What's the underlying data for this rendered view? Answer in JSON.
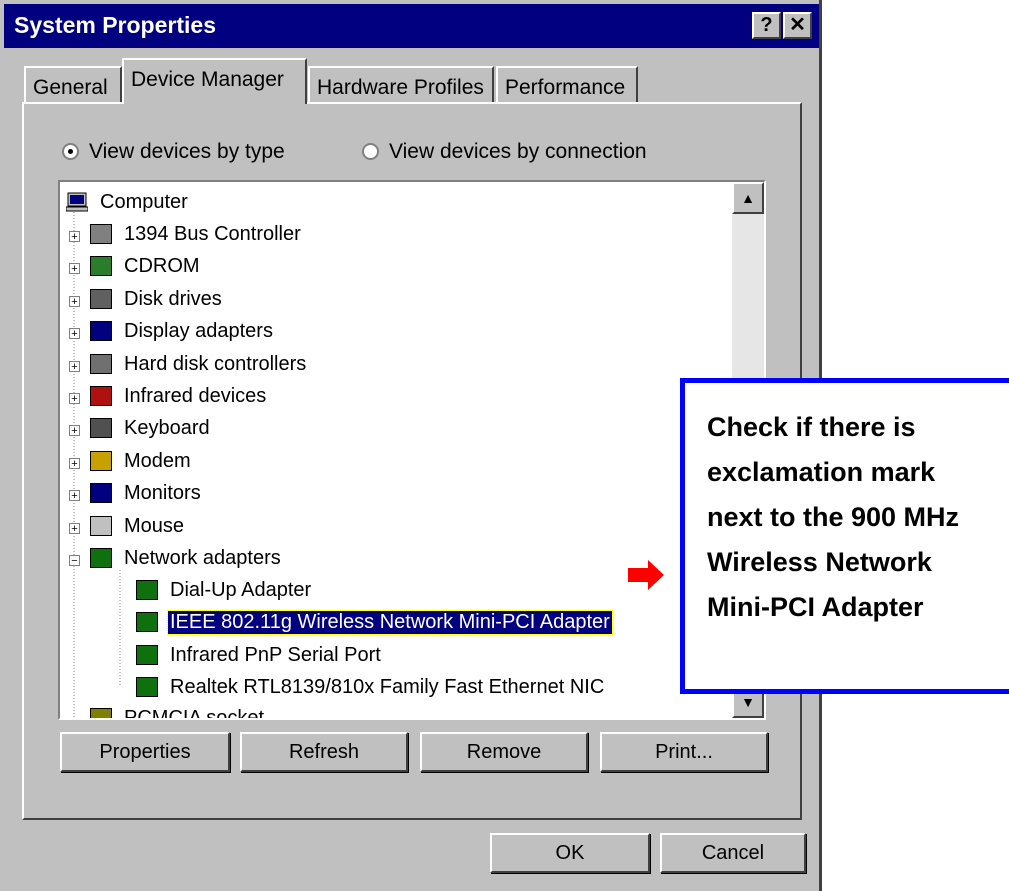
{
  "window": {
    "title": "System Properties",
    "help_label": "?",
    "close_label": "✕"
  },
  "tabs": [
    {
      "label": "General"
    },
    {
      "label": "Device Manager"
    },
    {
      "label": "Hardware Profiles"
    },
    {
      "label": "Performance"
    }
  ],
  "view_options": {
    "by_type": "View devices by type",
    "by_connection": "View devices by connection",
    "selected": "by_type"
  },
  "tree": {
    "root": "Computer",
    "items": [
      {
        "label": "1394 Bus Controller",
        "icon": "bus-controller-icon"
      },
      {
        "label": "CDROM",
        "icon": "cdrom-icon"
      },
      {
        "label": "Disk drives",
        "icon": "disk-drive-icon"
      },
      {
        "label": "Display adapters",
        "icon": "display-adapter-icon"
      },
      {
        "label": "Hard disk controllers",
        "icon": "hdd-controller-icon"
      },
      {
        "label": "Infrared devices",
        "icon": "infrared-icon"
      },
      {
        "label": "Keyboard",
        "icon": "keyboard-icon"
      },
      {
        "label": "Modem",
        "icon": "modem-icon"
      },
      {
        "label": "Monitors",
        "icon": "monitor-icon"
      },
      {
        "label": "Mouse",
        "icon": "mouse-icon"
      },
      {
        "label": "Network adapters",
        "icon": "network-adapter-icon"
      }
    ],
    "network_children": [
      {
        "label": "Dial-Up Adapter"
      },
      {
        "label": "IEEE 802.11g Wireless Network Mini-PCI Adapter"
      },
      {
        "label": "Infrared PnP Serial Port"
      },
      {
        "label": "Realtek RTL8139/810x Family Fast Ethernet NIC"
      }
    ],
    "partial_label": "PCMCIA socket"
  },
  "buttons": {
    "properties": "Properties",
    "refresh": "Refresh",
    "remove": "Remove",
    "print": "Print...",
    "ok": "OK",
    "cancel": "Cancel"
  },
  "callout": {
    "text": "Check if there is exclamation mark next to the 900 MHz Wireless Network Mini-PCI Adapter"
  },
  "colors": {
    "titlebar": "#000080",
    "selection": "#000080",
    "callout_border": "#0000ff",
    "arrow": "#ff0000"
  }
}
